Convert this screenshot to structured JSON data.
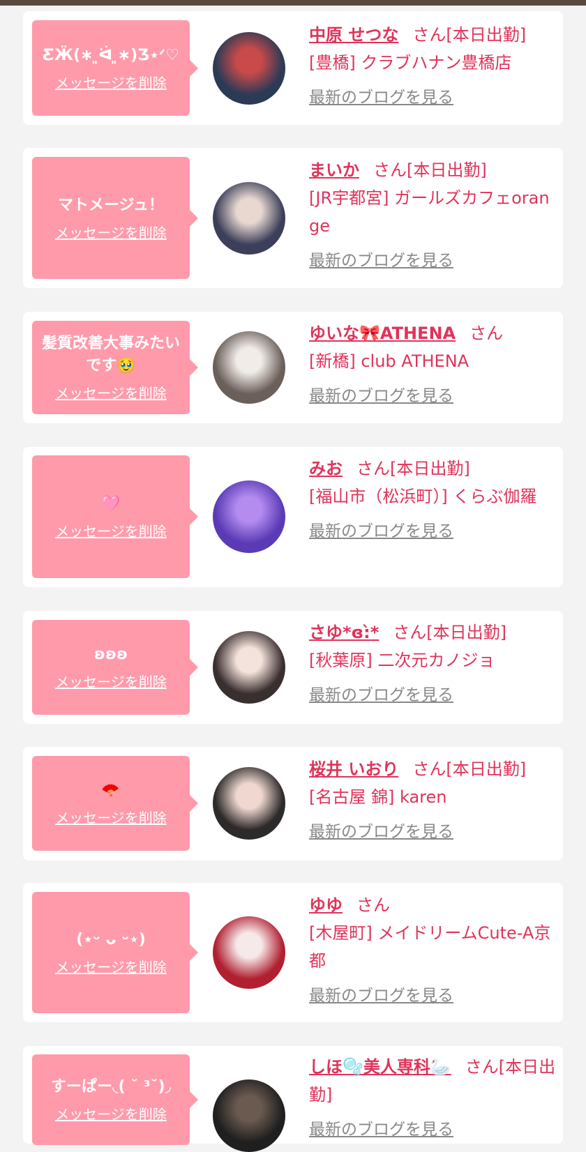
{
  "items": [
    {
      "message": "ƸӜ(∗ ͈ᐛ ͈∗)Ʒ⋆ᐟ♡",
      "delete_label": "メッセージを削除",
      "name": "中原 せつな",
      "suffix": "さん",
      "status": "[本日出勤]",
      "shop": "[豊橋] クラブハナン豊橋店",
      "blog_label": "最新のブログを見る",
      "avatar_colors": [
        "#2b3a55",
        "#c94a4a"
      ]
    },
    {
      "message": "マトメージュ！",
      "delete_label": "メッセージを削除",
      "name": "まいか",
      "suffix": "さん",
      "status": "[本日出勤]",
      "shop": "[JR宇都宮] ガールズカフェorange",
      "blog_label": "最新のブログを見る",
      "avatar_colors": [
        "#3c3f5a",
        "#e8d8d0"
      ]
    },
    {
      "message": "髪質改善大事みたいです🥹",
      "delete_label": "メッセージを削除",
      "name": "ゆいな🎀ATHENA",
      "suffix": "さん",
      "status": "",
      "shop": "[新橋] club ATHENA",
      "blog_label": "最新のブログを見る",
      "avatar_colors": [
        "#6b5f5a",
        "#f1ece8"
      ]
    },
    {
      "message": "🩷",
      "delete_label": "メッセージを削除",
      "name": "みお",
      "suffix": "さん",
      "status": "[本日出勤]",
      "shop": "[福山市（松浜町）] くらぶ伽羅",
      "blog_label": "最新のブログを見る",
      "avatar_colors": [
        "#5a3bb5",
        "#b48cf0"
      ]
    },
    {
      "message": "ʚʚʚ",
      "delete_label": "メッセージを削除",
      "name": "さゆ*ɞ:̀*",
      "suffix": "さん",
      "status": "[本日出勤]",
      "shop": "[秋葉原] 二次元カノジョ",
      "blog_label": "最新のブログを見る",
      "avatar_colors": [
        "#3a2f2f",
        "#f4e2dc"
      ]
    },
    {
      "message": "🪭",
      "delete_label": "メッセージを削除",
      "name": "桜井 いおり",
      "suffix": "さん",
      "status": "[本日出勤]",
      "shop": "[名古屋 錦] karen",
      "blog_label": "最新のブログを見る",
      "avatar_colors": [
        "#2d2a2a",
        "#f0d8d0"
      ]
    },
    {
      "message": "(⋆ᵕ ᴗ ᵕ⋆)",
      "delete_label": "メッセージを削除",
      "name": "ゆゆ",
      "suffix": "さん",
      "status": "",
      "shop": "[木屋町] メイドリームCute-A京都",
      "blog_label": "最新のブログを見る",
      "avatar_colors": [
        "#b02030",
        "#f6e9ea"
      ]
    },
    {
      "message": "すーぱー◟( ˘ ³˘)◞",
      "delete_label": "メッセージを削除",
      "name": "しほ🫧美人専科🦢",
      "suffix": "さん",
      "status": "[本日出勤]",
      "shop": "",
      "blog_label": "最新のブログを見る",
      "avatar_colors": [
        "#1f1f1f",
        "#6a5a50"
      ]
    }
  ]
}
